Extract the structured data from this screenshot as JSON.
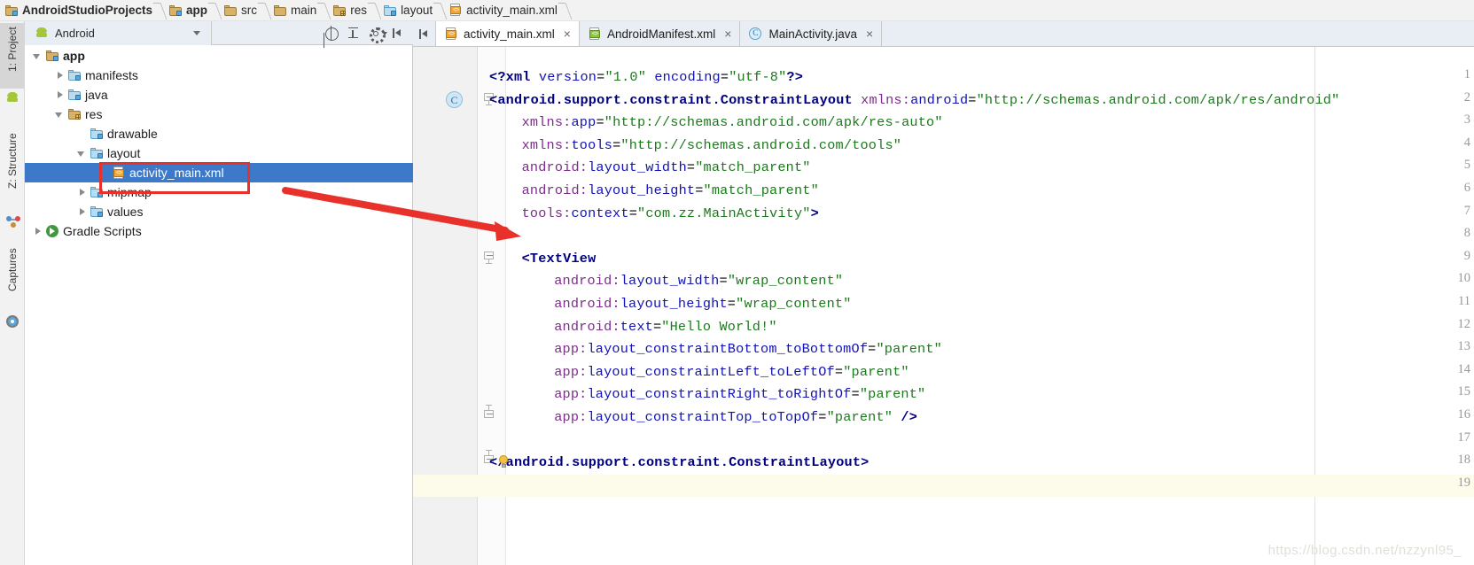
{
  "breadcrumb": {
    "items": [
      {
        "label": "AndroidStudioProjects",
        "icon": "folder-badge-icon",
        "bold": true
      },
      {
        "label": "app",
        "icon": "folder-badge-icon",
        "bold": true
      },
      {
        "label": "src",
        "icon": "folder-icon",
        "bold": false
      },
      {
        "label": "main",
        "icon": "folder-icon",
        "bold": false
      },
      {
        "label": "res",
        "icon": "folder-res-icon",
        "bold": false
      },
      {
        "label": "layout",
        "icon": "folder-blue-icon",
        "bold": false
      },
      {
        "label": "activity_main.xml",
        "icon": "xml-file-icon",
        "bold": false
      }
    ]
  },
  "toolstrip": {
    "tabs": [
      {
        "label": "1: Project",
        "icon": "android-icon",
        "selected": true
      },
      {
        "label": "Z: Structure",
        "icon": "structure-icon",
        "selected": false
      },
      {
        "label": "Captures",
        "icon": "captures-icon",
        "selected": false
      }
    ]
  },
  "project_panel": {
    "view_selector": {
      "label": "Android",
      "icon": "android-icon"
    },
    "toolbar_icons": [
      "locate-target-icon",
      "collapse-all-icon",
      "settings-gear-icon",
      "hide-panel-icon"
    ],
    "tree": [
      {
        "label": "app",
        "icon": "folder-badge-icon",
        "twisty": "open",
        "depth": 0,
        "bold": true,
        "selected": false
      },
      {
        "label": "manifests",
        "icon": "folder-blue-icon",
        "twisty": "closed",
        "depth": 1,
        "bold": false,
        "selected": false
      },
      {
        "label": "java",
        "icon": "folder-blue-icon",
        "twisty": "closed",
        "depth": 1,
        "bold": false,
        "selected": false
      },
      {
        "label": "res",
        "icon": "folder-res-icon",
        "twisty": "open",
        "depth": 1,
        "bold": false,
        "selected": false
      },
      {
        "label": "drawable",
        "icon": "folder-blue-icon",
        "twisty": "none",
        "depth": 2,
        "bold": false,
        "selected": false
      },
      {
        "label": "layout",
        "icon": "folder-blue-icon",
        "twisty": "open",
        "depth": 2,
        "bold": false,
        "selected": false
      },
      {
        "label": "activity_main.xml",
        "icon": "xml-file-icon",
        "twisty": "none",
        "depth": 3,
        "bold": false,
        "selected": true
      },
      {
        "label": "mipmap",
        "icon": "folder-blue-icon",
        "twisty": "closed",
        "depth": 2,
        "bold": false,
        "selected": false
      },
      {
        "label": "values",
        "icon": "folder-blue-icon",
        "twisty": "closed",
        "depth": 2,
        "bold": false,
        "selected": false
      },
      {
        "label": "Gradle Scripts",
        "icon": "gradle-icon",
        "twisty": "closed",
        "depth": 0,
        "bold": false,
        "selected": false
      }
    ]
  },
  "editor": {
    "hide_tabs_icon": "hide-tabs-icon",
    "tabs": [
      {
        "label": "activity_main.xml",
        "icon": "xml-file-icon",
        "active": true,
        "close": "×"
      },
      {
        "label": "AndroidManifest.xml",
        "icon": "manifest-file-icon",
        "active": false,
        "close": "×"
      },
      {
        "label": "MainActivity.java",
        "icon": "java-class-icon",
        "active": false,
        "close": "×"
      }
    ],
    "current_line": 19,
    "line_count": 19,
    "lines": [
      {
        "n": 1,
        "indent": 0,
        "tokens": [
          {
            "t": "<?",
            "c": "pt"
          },
          {
            "t": "xml",
            "c": "tag"
          },
          {
            "t": " ",
            "c": "plain"
          },
          {
            "t": "version",
            "c": "attr"
          },
          {
            "t": "=",
            "c": "plain"
          },
          {
            "t": "\"1.0\"",
            "c": "val"
          },
          {
            "t": " ",
            "c": "plain"
          },
          {
            "t": "encoding",
            "c": "attr"
          },
          {
            "t": "=",
            "c": "plain"
          },
          {
            "t": "\"utf-8\"",
            "c": "val"
          },
          {
            "t": "?>",
            "c": "pt"
          }
        ]
      },
      {
        "n": 2,
        "indent": 0,
        "fold": "open",
        "mark": "C",
        "tokens": [
          {
            "t": "<",
            "c": "pt"
          },
          {
            "t": "android.support.constraint.ConstraintLayout",
            "c": "tag"
          },
          {
            "t": " ",
            "c": "plain"
          },
          {
            "t": "xmlns:",
            "c": "ns"
          },
          {
            "t": "android",
            "c": "attr"
          },
          {
            "t": "=",
            "c": "plain"
          },
          {
            "t": "\"http://schemas.android.com/apk/res/android\"",
            "c": "val"
          }
        ]
      },
      {
        "n": 3,
        "indent": 4,
        "tokens": [
          {
            "t": "xmlns:",
            "c": "ns"
          },
          {
            "t": "app",
            "c": "attr"
          },
          {
            "t": "=",
            "c": "plain"
          },
          {
            "t": "\"http://schemas.android.com/apk/res-auto\"",
            "c": "val"
          }
        ]
      },
      {
        "n": 4,
        "indent": 4,
        "tokens": [
          {
            "t": "xmlns:",
            "c": "ns"
          },
          {
            "t": "tools",
            "c": "attr"
          },
          {
            "t": "=",
            "c": "plain"
          },
          {
            "t": "\"http://schemas.android.com/tools\"",
            "c": "val"
          }
        ]
      },
      {
        "n": 5,
        "indent": 4,
        "tokens": [
          {
            "t": "android:",
            "c": "ns"
          },
          {
            "t": "layout_width",
            "c": "attr"
          },
          {
            "t": "=",
            "c": "plain"
          },
          {
            "t": "\"match_parent\"",
            "c": "val"
          }
        ]
      },
      {
        "n": 6,
        "indent": 4,
        "tokens": [
          {
            "t": "android:",
            "c": "ns"
          },
          {
            "t": "layout_height",
            "c": "attr"
          },
          {
            "t": "=",
            "c": "plain"
          },
          {
            "t": "\"match_parent\"",
            "c": "val"
          }
        ]
      },
      {
        "n": 7,
        "indent": 4,
        "tokens": [
          {
            "t": "tools:",
            "c": "ns"
          },
          {
            "t": "context",
            "c": "attr"
          },
          {
            "t": "=",
            "c": "plain"
          },
          {
            "t": "\"com.zz.MainActivity\"",
            "c": "val"
          },
          {
            "t": ">",
            "c": "pt"
          }
        ]
      },
      {
        "n": 8,
        "indent": 0,
        "tokens": []
      },
      {
        "n": 9,
        "indent": 4,
        "fold": "open",
        "tokens": [
          {
            "t": "<",
            "c": "pt"
          },
          {
            "t": "TextView",
            "c": "tag"
          }
        ]
      },
      {
        "n": 10,
        "indent": 8,
        "tokens": [
          {
            "t": "android:",
            "c": "ns"
          },
          {
            "t": "layout_width",
            "c": "attr"
          },
          {
            "t": "=",
            "c": "plain"
          },
          {
            "t": "\"wrap_content\"",
            "c": "val"
          }
        ]
      },
      {
        "n": 11,
        "indent": 8,
        "tokens": [
          {
            "t": "android:",
            "c": "ns"
          },
          {
            "t": "layout_height",
            "c": "attr"
          },
          {
            "t": "=",
            "c": "plain"
          },
          {
            "t": "\"wrap_content\"",
            "c": "val"
          }
        ]
      },
      {
        "n": 12,
        "indent": 8,
        "tokens": [
          {
            "t": "android:",
            "c": "ns"
          },
          {
            "t": "text",
            "c": "attr"
          },
          {
            "t": "=",
            "c": "plain"
          },
          {
            "t": "\"Hello World!\"",
            "c": "val"
          }
        ]
      },
      {
        "n": 13,
        "indent": 8,
        "tokens": [
          {
            "t": "app:",
            "c": "ns"
          },
          {
            "t": "layout_constraintBottom_toBottomOf",
            "c": "attr"
          },
          {
            "t": "=",
            "c": "plain"
          },
          {
            "t": "\"parent\"",
            "c": "val"
          }
        ]
      },
      {
        "n": 14,
        "indent": 8,
        "tokens": [
          {
            "t": "app:",
            "c": "ns"
          },
          {
            "t": "layout_constraintLeft_toLeftOf",
            "c": "attr"
          },
          {
            "t": "=",
            "c": "plain"
          },
          {
            "t": "\"parent\"",
            "c": "val"
          }
        ]
      },
      {
        "n": 15,
        "indent": 8,
        "tokens": [
          {
            "t": "app:",
            "c": "ns"
          },
          {
            "t": "layout_constraintRight_toRightOf",
            "c": "attr"
          },
          {
            "t": "=",
            "c": "plain"
          },
          {
            "t": "\"parent\"",
            "c": "val"
          }
        ]
      },
      {
        "n": 16,
        "indent": 8,
        "fold": "close",
        "tokens": [
          {
            "t": "app:",
            "c": "ns"
          },
          {
            "t": "layout_constraintTop_toTopOf",
            "c": "attr"
          },
          {
            "t": "=",
            "c": "plain"
          },
          {
            "t": "\"parent\"",
            "c": "val"
          },
          {
            "t": " ",
            "c": "plain"
          },
          {
            "t": "/>",
            "c": "pt"
          }
        ]
      },
      {
        "n": 17,
        "indent": 0,
        "tokens": []
      },
      {
        "n": 18,
        "indent": 0,
        "fold": "close",
        "bulb": true,
        "tokens": [
          {
            "t": "</",
            "c": "pt"
          },
          {
            "t": "android.support.constraint.ConstraintLayout",
            "c": "tag"
          },
          {
            "t": ">",
            "c": "pt"
          }
        ]
      },
      {
        "n": 19,
        "indent": 0,
        "tokens": []
      }
    ]
  },
  "annotations": {
    "highlight_rect": {
      "label": "red-highlight-around-activity-main-xml"
    },
    "arrow": {
      "label": "red-arrow-pointing-to-editor"
    },
    "arrow_color": "#e8312a",
    "rect_color": "#e8312a"
  },
  "watermark": {
    "text": "https://blog.csdn.net/nzzynl95_"
  },
  "colors": {
    "selection_blue": "#3c79c8",
    "panel_header": "#e8eef4",
    "gutter": "#f1f1f1",
    "current_line": "#fdfbea",
    "tag": "#000080",
    "attribute": "#1212b5",
    "namespace": "#7c2d8a",
    "value": "#1a7a1a"
  }
}
